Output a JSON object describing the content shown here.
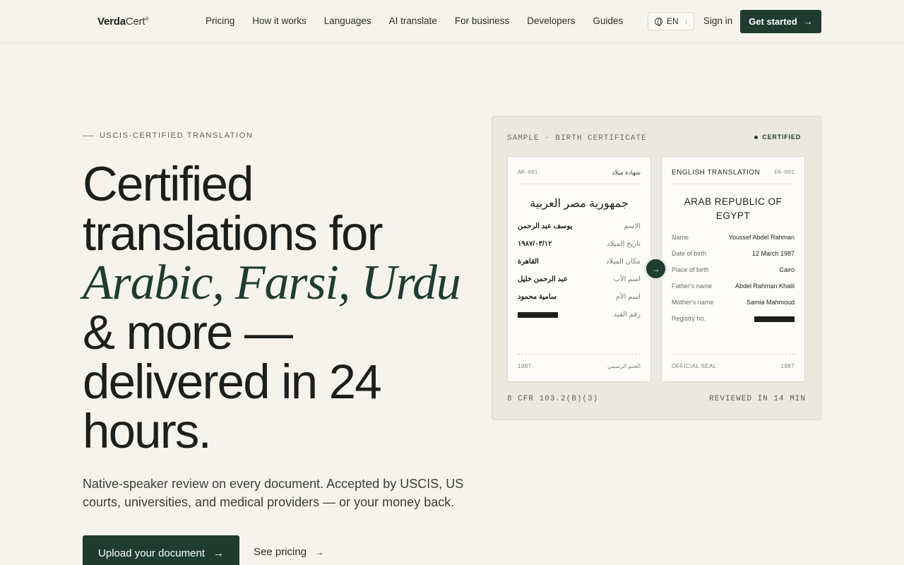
{
  "nav": {
    "logo_bold": "Verda",
    "logo_thin": "Cert",
    "logo_mark": "®",
    "menu": [
      "Pricing",
      "How it works",
      "Languages",
      "AI translate",
      "For business",
      "Developers",
      "Guides"
    ],
    "lang": "EN",
    "sign_in": "Sign in",
    "get_started": "Get started",
    "arrow": "→",
    "caret": "↓"
  },
  "hero": {
    "eyebrow": "USCIS-CERTIFIED TRANSLATION",
    "line1": "Certified",
    "line2": "translations for",
    "line3": "Arabic, Farsi, Urdu",
    "line4": "& more —",
    "line5": "delivered in 24",
    "line6": "hours.",
    "subtitle": "Native-speaker review on every document. Accepted by USCIS, US courts, universities, and medical providers — or your money back.",
    "upload": "Upload your document",
    "see_pricing": "See pricing",
    "arrow": "→"
  },
  "sample": {
    "header": "SAMPLE · BIRTH CERTIFICATE",
    "badge": "CERTIFIED",
    "footer_left": "8 CFR 103.2(B)(3)",
    "footer_right": "REVIEWED IN 14 MIN",
    "arrow": "→",
    "arabic": {
      "id": "AR-001",
      "doc_type": "شهادة ميلاد",
      "title": "جمهورية مصر العربية",
      "rows": [
        {
          "k": "الاسم",
          "v": "يوسف عبد الرحمن"
        },
        {
          "k": "تاريخ الميلاد",
          "v": "١٩٨٧/٠٣/١٢"
        },
        {
          "k": "مكان الميلاد",
          "v": "القاهرة"
        },
        {
          "k": "اسم الأب",
          "v": "عبد الرحمن خليل"
        },
        {
          "k": "اسم الأم",
          "v": "سامية محمود"
        },
        {
          "k": "رقم القيد",
          "v": ""
        }
      ],
      "foot_left": "1987",
      "foot_right": "الختم الرسمي"
    },
    "english": {
      "heading": "ENGLISH TRANSLATION",
      "id": "EN-001",
      "title": "ARAB REPUBLIC OF EGYPT",
      "rows": [
        {
          "k": "Name",
          "v": "Youssef Abdel Rahman"
        },
        {
          "k": "Date of birth",
          "v": "12 March 1987"
        },
        {
          "k": "Place of birth",
          "v": "Cairo"
        },
        {
          "k": "Father's name",
          "v": "Abdel Rahman Khalil"
        },
        {
          "k": "Mother's name",
          "v": "Samia Mahmoud"
        },
        {
          "k": "Registry no.",
          "v": ""
        }
      ],
      "foot_left": "OFFICIAL SEAL",
      "foot_right": "1987"
    }
  }
}
